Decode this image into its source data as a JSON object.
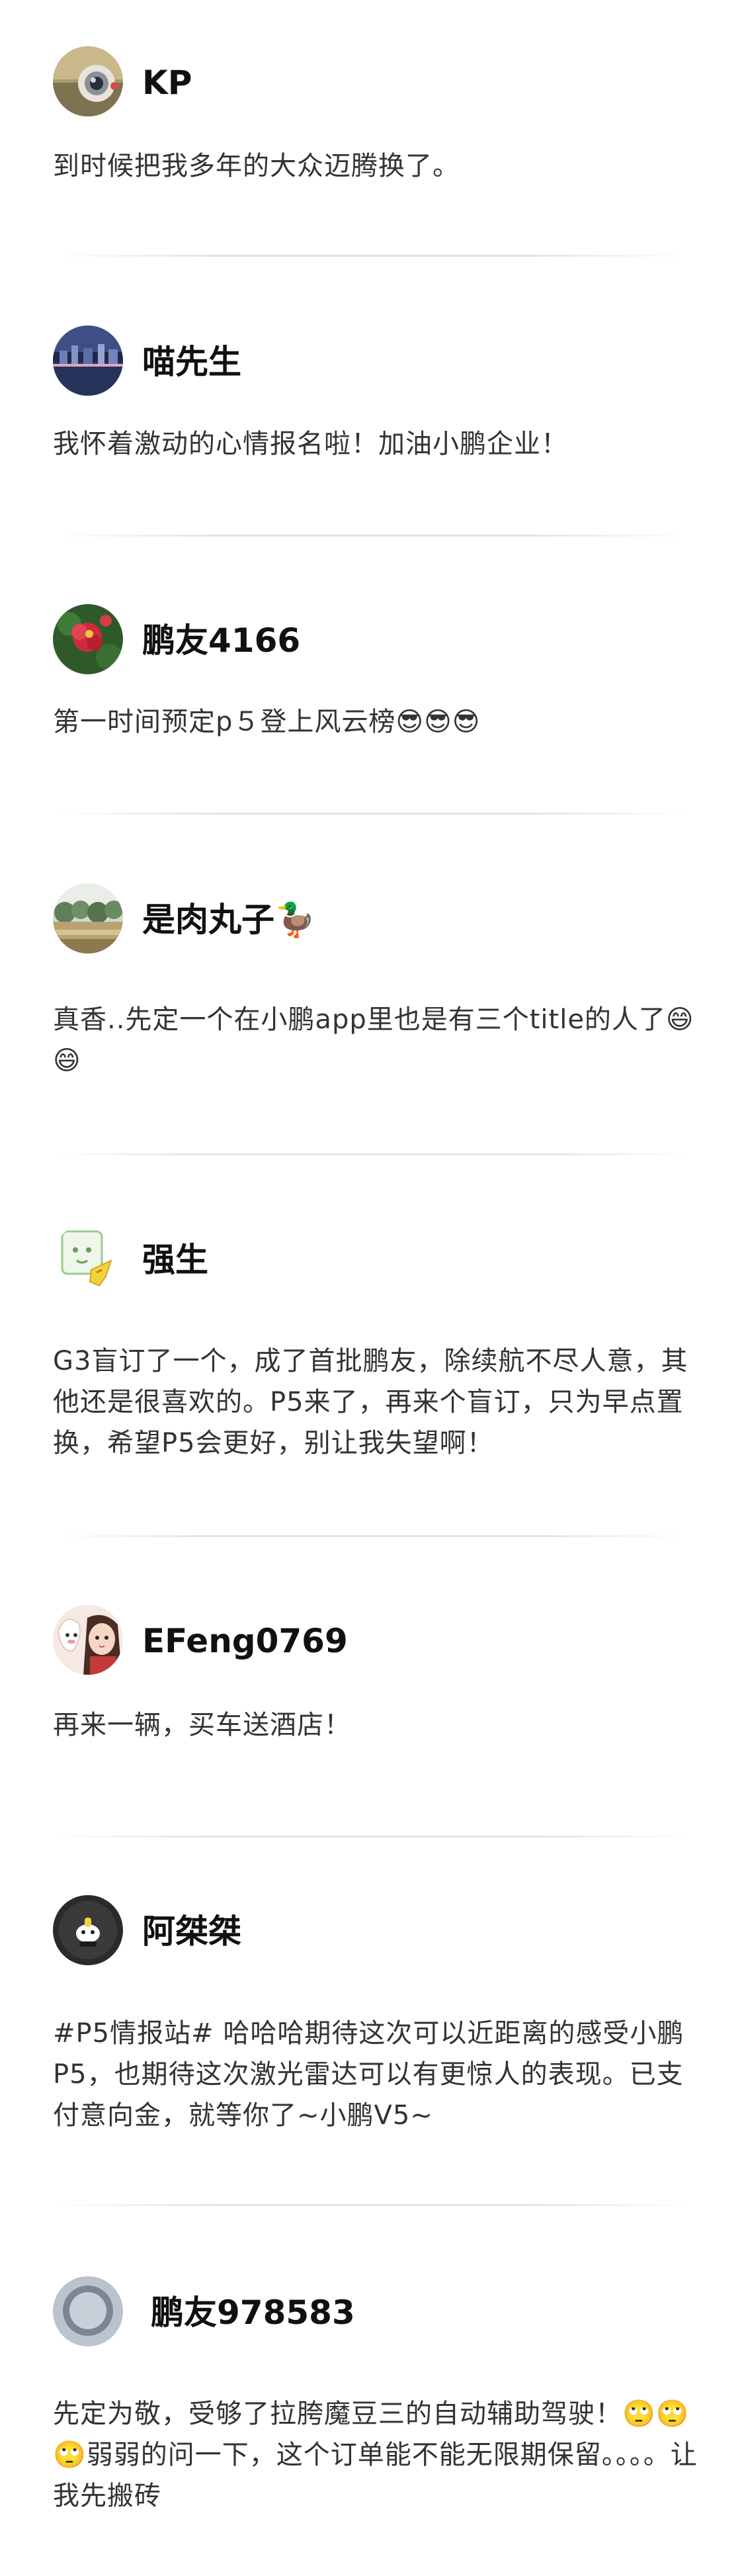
{
  "comments": [
    {
      "name": "KP",
      "text": "到时候把我多年的大众迈腾换了。",
      "avatar_icon": "camera-lens-photo-avatar"
    },
    {
      "name": "喵先生",
      "text": "我怀着激动的心情报名啦！加油小鹏企业！",
      "avatar_icon": "night-city-photo-avatar"
    },
    {
      "name": "鹏友4166",
      "text": "第一时间预定p５登上风云榜😎😎😎",
      "avatar_icon": "red-flower-photo-avatar"
    },
    {
      "name": "是肉丸子🦆",
      "text": "真香..先定一个在小鹏app里也是有三个title的人了😄😄",
      "avatar_icon": "landscape-photo-avatar"
    },
    {
      "name": "强生",
      "text": "G3盲订了一个，成了首批鹏友，除续航不尽人意，其他还是很喜欢的。P5来了，再来个盲订，只为早点置换，希望P5会更好，别让我失望啊！",
      "avatar_icon": "cartoon-outlet-avatar"
    },
    {
      "name": "EFeng0769",
      "text": "再来一辆，买车送酒店！",
      "avatar_icon": "anime-girl-avatar"
    },
    {
      "name": "阿桀桀",
      "text": "#P5情报站# 哈哈哈期待这次可以近距离的感受小鹏P5，也期待这次激光雷达可以有更惊人的表现。已支付意向金，就等你了~小鹏V5~",
      "avatar_icon": "dark-cartoon-avatar"
    },
    {
      "name": "鹏友978583",
      "text": "先定为敬，受够了拉胯魔豆三的自动辅助驾驶！🙄🙄🙄弱弱的问一下，这个订单能不能无限期保留。。。。让我先搬砖",
      "avatar_icon": "default-user-avatar"
    }
  ]
}
